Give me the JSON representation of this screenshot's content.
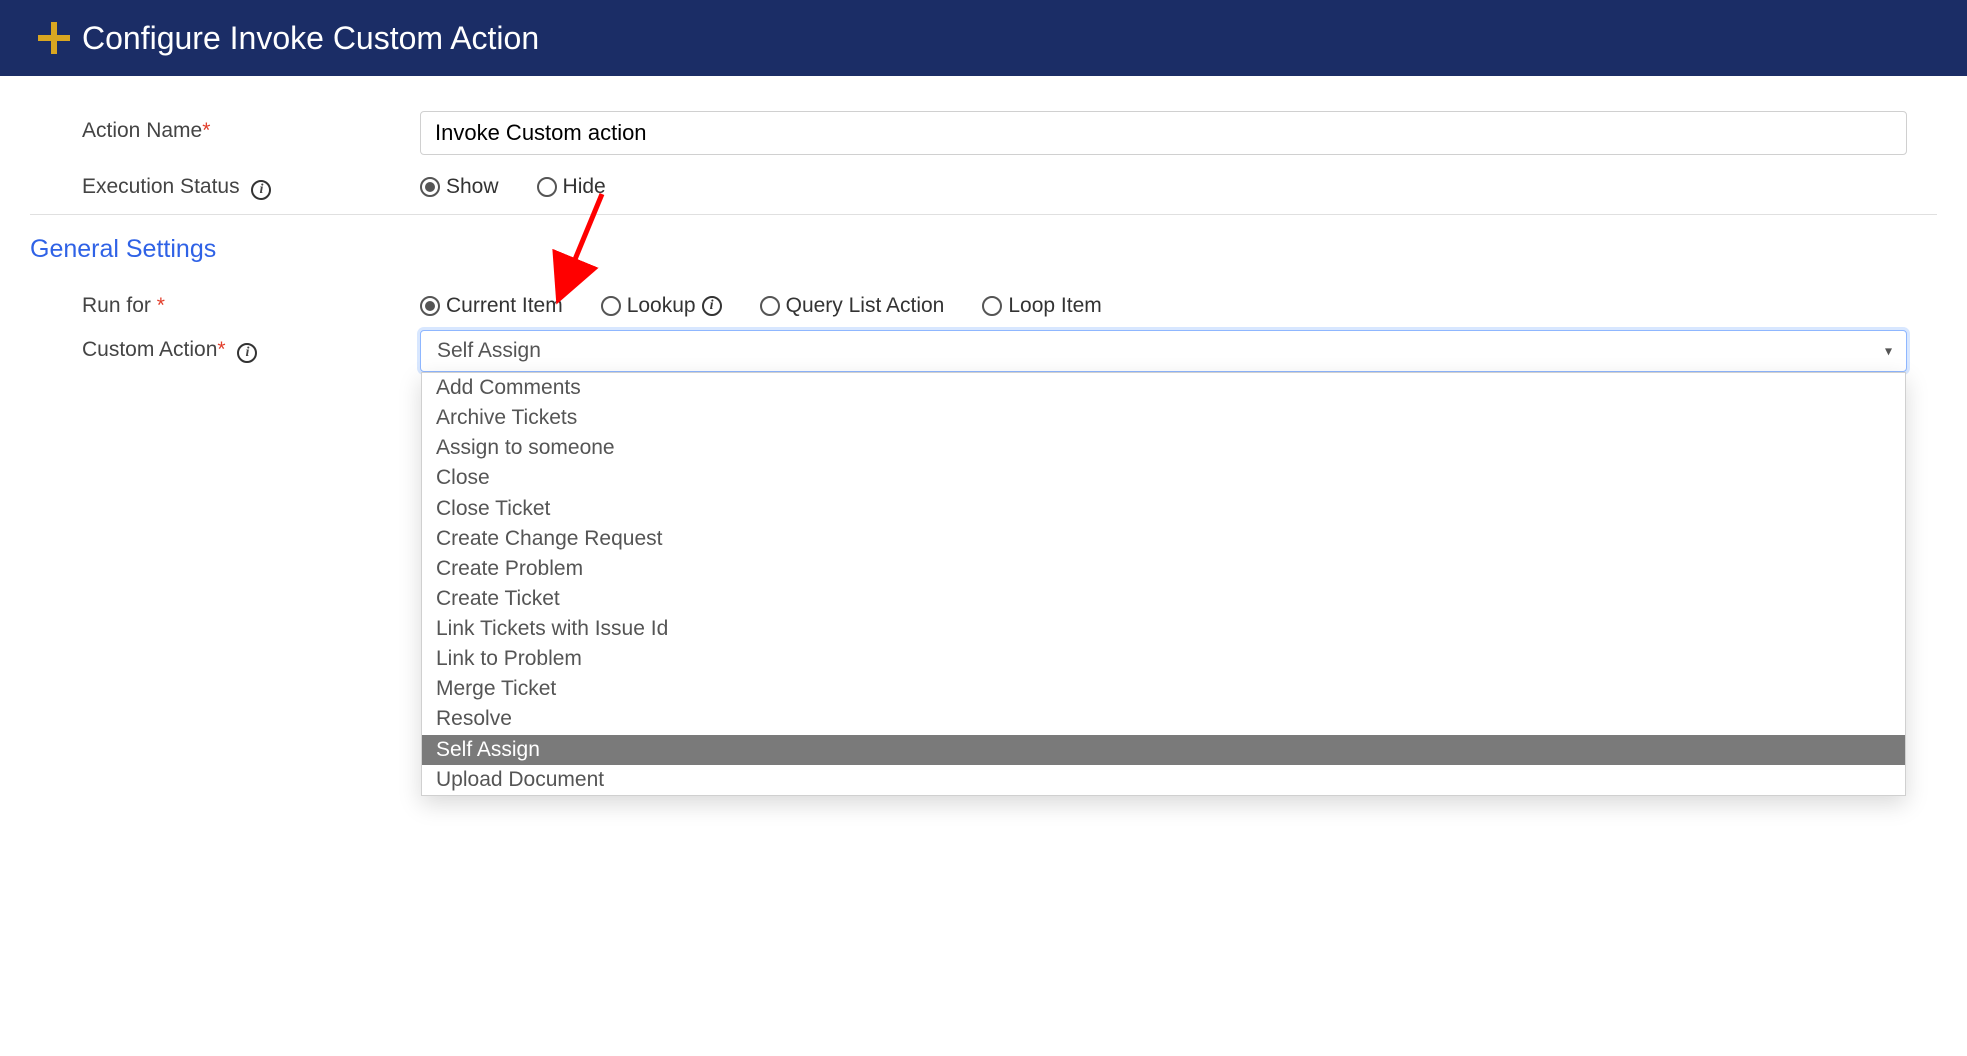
{
  "header": {
    "title": "Configure Invoke Custom Action"
  },
  "form": {
    "action_name": {
      "label": "Action Name",
      "value": "Invoke Custom action"
    },
    "execution_status": {
      "label": "Execution Status",
      "options": {
        "show": "Show",
        "hide": "Hide"
      },
      "selected": "show"
    }
  },
  "section": {
    "general": "General Settings"
  },
  "run_for": {
    "label": "Run for",
    "options": {
      "current_item": "Current Item",
      "lookup": "Lookup",
      "query_list_action": "Query List Action",
      "loop_item": "Loop Item"
    },
    "selected": "current_item"
  },
  "custom_action": {
    "label": "Custom Action",
    "selected": "Self Assign",
    "options": [
      "Add Comments",
      "Archive Tickets",
      "Assign to someone",
      "Close",
      "Close Ticket",
      "Create Change Request",
      "Create Problem",
      "Create Ticket",
      "Link Tickets with Issue Id",
      "Link to Problem",
      "Merge Ticket",
      "Resolve",
      "Self Assign",
      "Upload Document"
    ]
  }
}
